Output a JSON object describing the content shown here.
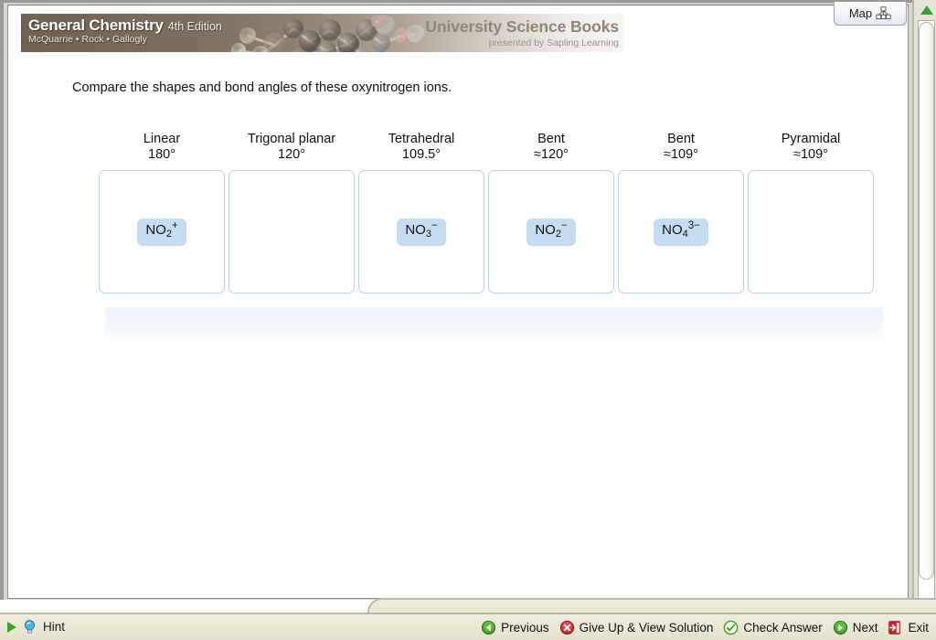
{
  "window": {
    "map_button": {
      "label": "Map",
      "icon": "sitemap-icon"
    },
    "scrollbar": {
      "up_icon": "triangle-up-icon",
      "down_icon": "triangle-down-icon"
    }
  },
  "banner": {
    "book_title": "General Chemistry",
    "edition": "4th Edition",
    "authors": "McQuarrie • Rock • Gallogly",
    "publisher": "University Science Books",
    "publisher_tagline": "presented by Sapling Learning",
    "artwork": "molecule-model-illustration",
    "colors": {
      "left": "#6f6252",
      "right": "#f7f6f4"
    }
  },
  "question": {
    "prompt": "Compare the shapes and bond angles of these oxynitrogen ions."
  },
  "columns": [
    {
      "shape": "Linear",
      "angle": "180°",
      "chip": {
        "formula": "NO",
        "sub": "2",
        "charge": "+",
        "label": "NO2+"
      }
    },
    {
      "shape": "Trigonal planar",
      "angle": "120°",
      "chip": null
    },
    {
      "shape": "Tetrahedral",
      "angle": "109.5°",
      "chip": {
        "formula": "NO",
        "sub": "3",
        "charge": "−",
        "label": "NO3-"
      }
    },
    {
      "shape": "Bent",
      "angle": "≈120°",
      "chip": {
        "formula": "NO",
        "sub": "2",
        "charge": "−",
        "label": "NO2-"
      }
    },
    {
      "shape": "Bent",
      "angle": "≈109°",
      "chip": {
        "formula": "NO",
        "sub": "4",
        "charge": "3−",
        "label": "NO4 3-"
      }
    },
    {
      "shape": "Pyramidal",
      "angle": "≈109°",
      "chip": null
    }
  ],
  "bank": {
    "items": [],
    "background": "#eaf2fa"
  },
  "footer": {
    "hint": {
      "label": "Hint",
      "play_icon": "play-triangle-icon",
      "bulb_icon": "lightbulb-icon"
    },
    "nav": [
      {
        "label": "Previous",
        "icon": "arrow-left-circle-icon",
        "color": "#4aa02c"
      },
      {
        "label": "Give Up & View Solution",
        "icon": "x-circle-icon",
        "color": "#cc2222"
      },
      {
        "label": "Check Answer",
        "icon": "check-circle-icon",
        "color": "#4aa02c"
      },
      {
        "label": "Next",
        "icon": "arrow-right-circle-icon",
        "color": "#4aa02c"
      },
      {
        "label": "Exit",
        "icon": "exit-door-icon",
        "color": "#cc2222"
      }
    ]
  },
  "theme": {
    "chip_bg": "#c6dcf1",
    "box_border": "#b6d3ea",
    "footer_bg": "#eae7d6"
  }
}
